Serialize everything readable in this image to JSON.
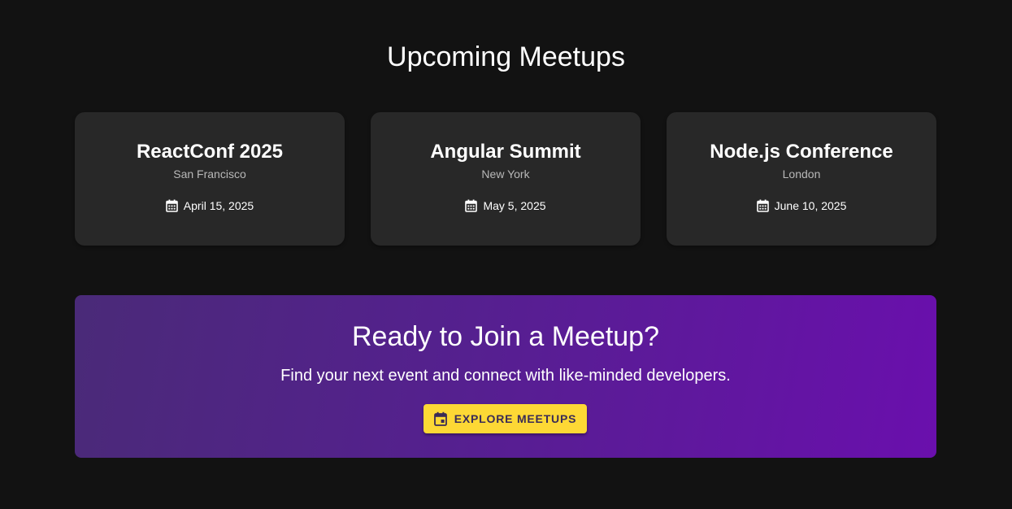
{
  "header": {
    "title": "Upcoming Meetups"
  },
  "meetups": [
    {
      "name": "ReactConf 2025",
      "location": "San Francisco",
      "date": "April 15, 2025",
      "icon": "calendar-icon"
    },
    {
      "name": "Angular Summit",
      "location": "New York",
      "date": "May 5, 2025",
      "icon": "calendar-icon"
    },
    {
      "name": "Node.js Conference",
      "location": "London",
      "date": "June 10, 2025",
      "icon": "calendar-icon"
    }
  ],
  "cta": {
    "title": "Ready to Join a Meetup?",
    "subtitle": "Find your next event and connect with like-minded developers.",
    "button_label": "Explore Meetups",
    "button_icon": "event-icon"
  },
  "colors": {
    "background": "#121212",
    "card": "#282828",
    "cta_gradient_start": "#4a2a78",
    "cta_gradient_end": "#6a0fad",
    "button": "#fdd835",
    "button_text": "#3a2b56"
  }
}
